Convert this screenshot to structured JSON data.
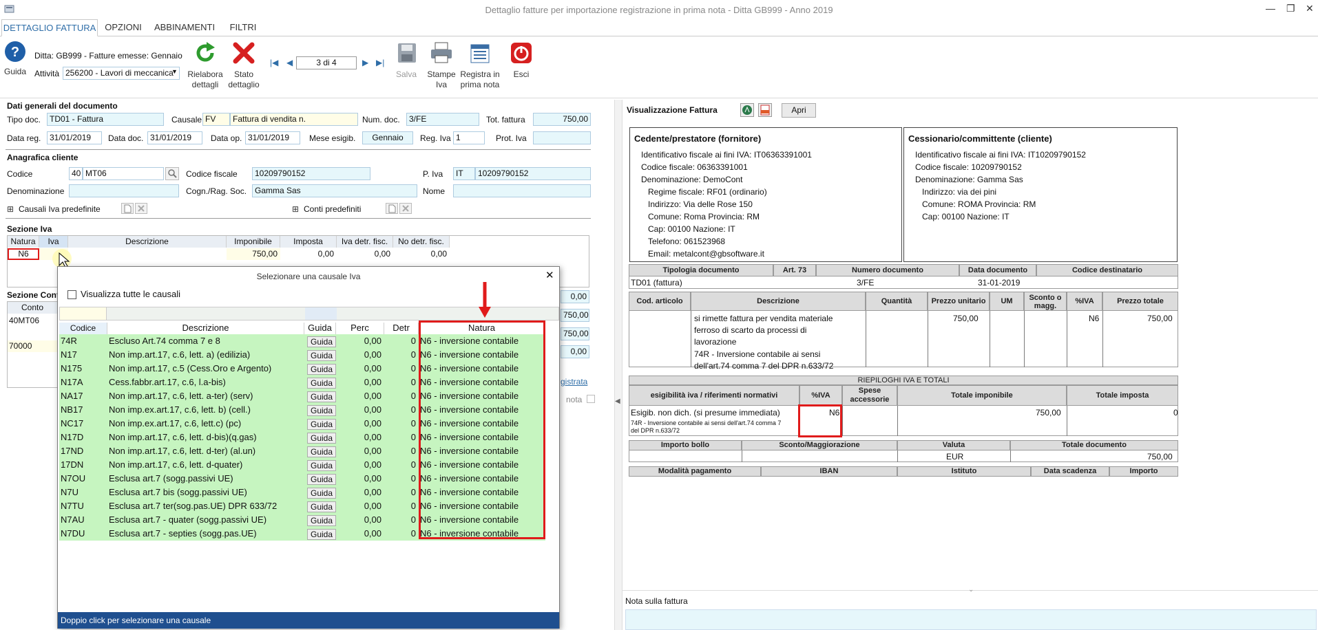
{
  "window": {
    "title": "Dettaglio fatture per importazione registrazione in prima nota - Ditta GB999 - Anno 2019",
    "minimize": "—",
    "maximize": "❐",
    "close": "✕"
  },
  "tabs": [
    "DETTAGLIO FATTURA",
    "OPZIONI",
    "ABBINAMENTI",
    "FILTRI"
  ],
  "ribbon": {
    "guida": "Guida",
    "ditta": "Ditta: GB999 - Fatture emesse: Gennaio",
    "attivita_label": "Attività",
    "attivita_value": "256200 - Lavori di meccanica",
    "rielabora": [
      "Rielabora",
      "dettagli"
    ],
    "stato": [
      "Stato",
      "dettaglio"
    ],
    "pager": "3 di 4",
    "salva": "Salva",
    "stampe": [
      "Stampe",
      "Iva"
    ],
    "registra": [
      "Registra in",
      "prima nota"
    ],
    "esci": "Esci"
  },
  "dati": {
    "section": "Dati generali del documento",
    "tipo_label": "Tipo doc.",
    "tipo_value": "TD01 - Fattura",
    "causale_label": "Causale",
    "causale_code": "FV",
    "causale_desc": "Fattura di vendita n.",
    "num_label": "Num. doc.",
    "num_value": "3/FE",
    "tot_label": "Tot. fattura",
    "tot_value": "750,00",
    "datareg_label": "Data reg.",
    "datareg_value": "31/01/2019",
    "datadoc_label": "Data doc.",
    "datadoc_value": "31/01/2019",
    "dataop_label": "Data op.",
    "dataop_value": "31/01/2019",
    "mese_label": "Mese esigib.",
    "mese_value": "Gennaio",
    "regiva_label": "Reg. Iva",
    "regiva_value": "1",
    "prot_label": "Prot. Iva",
    "prot_value": ""
  },
  "cliente": {
    "section": "Anagrafica cliente",
    "codice_label": "Codice",
    "codice_a": "40",
    "codice_b": "MT06",
    "cf_label": "Codice fiscale",
    "cf_value": "10209790152",
    "piva_label": "P. Iva",
    "piva_country": "IT",
    "piva_value": "10209790152",
    "denom_label": "Denominazione",
    "denom_value": "",
    "cogn_label": "Cogn./Rag. Soc.",
    "cogn_value": "Gamma Sas",
    "nome_label": "Nome",
    "nome_value": "",
    "causali_pred": "Causali Iva predefinite",
    "conti_pred": "Conti predefiniti",
    "expand": "⊞"
  },
  "iva": {
    "section": "Sezione Iva",
    "headers": [
      "Natura",
      "Iva",
      "Descrizione",
      "Imponibile",
      "Imposta",
      "Iva detr. fisc.",
      "No detr. fisc."
    ],
    "row": {
      "natura": "N6",
      "iva": "",
      "descrizione": "",
      "imponibile": "750,00",
      "imposta": "0,00",
      "detr": "0,00",
      "nodetr": "0,00"
    }
  },
  "conti": {
    "section": "Sezione Cont",
    "col": "Conto",
    "rows": [
      "40MT06",
      "",
      "70000"
    ],
    "right_values": [
      "0,00",
      "750,00",
      "750,00",
      "0,00"
    ],
    "link": "gistrata",
    "nota": "nota"
  },
  "popup": {
    "title": "Selezionare una causale Iva",
    "close": "✕",
    "checkbox_label": "Visualizza tutte le causali",
    "headers": [
      "Codice",
      "Descrizione",
      "Guida",
      "Perc",
      "Detr",
      "Natura"
    ],
    "rows": [
      {
        "codice": "74R",
        "desc": "Escluso Art.74 comma 7 e 8",
        "guida": "Guida",
        "perc": "0,00",
        "detr": "0",
        "natura": "N6 - inversione contabile"
      },
      {
        "codice": "N17",
        "desc": "Non imp.art.17, c.6, lett. a) (edilizia)",
        "guida": "Guida",
        "perc": "0,00",
        "detr": "0",
        "natura": "N6 - inversione contabile"
      },
      {
        "codice": "N175",
        "desc": "Non imp.art.17, c.5 (Cess.Oro e Argento)",
        "guida": "Guida",
        "perc": "0,00",
        "detr": "0",
        "natura": "N6 - inversione contabile"
      },
      {
        "codice": "N17A",
        "desc": "Cess.fabbr.art.17, c.6, l.a-bis)",
        "guida": "Guida",
        "perc": "0,00",
        "detr": "0",
        "natura": "N6 - inversione contabile"
      },
      {
        "codice": "NA17",
        "desc": "Non imp.art.17, c.6, lett. a-ter) (serv)",
        "guida": "Guida",
        "perc": "0,00",
        "detr": "0",
        "natura": "N6 - inversione contabile"
      },
      {
        "codice": "NB17",
        "desc": "Non imp.ex.art.17, c.6, lett. b) (cell.)",
        "guida": "Guida",
        "perc": "0,00",
        "detr": "0",
        "natura": "N6 - inversione contabile"
      },
      {
        "codice": "NC17",
        "desc": "Non imp.ex.art.17, c.6, lett.c) (pc)",
        "guida": "Guida",
        "perc": "0,00",
        "detr": "0",
        "natura": "N6 - inversione contabile"
      },
      {
        "codice": "N17D",
        "desc": "Non imp.art.17, c.6, lett. d-bis)(q.gas)",
        "guida": "Guida",
        "perc": "0,00",
        "detr": "0",
        "natura": "N6 - inversione contabile"
      },
      {
        "codice": "17ND",
        "desc": "Non imp.art.17, c.6, lett. d-ter) (al.un)",
        "guida": "Guida",
        "perc": "0,00",
        "detr": "0",
        "natura": "N6 - inversione contabile"
      },
      {
        "codice": "17DN",
        "desc": "Non imp.art.17, c.6, lett. d-quater)",
        "guida": "Guida",
        "perc": "0,00",
        "detr": "0",
        "natura": "N6 - inversione contabile"
      },
      {
        "codice": "N7OU",
        "desc": "Esclusa art.7 (sogg.passivi UE)",
        "guida": "Guida",
        "perc": "0,00",
        "detr": "0",
        "natura": "N6 - inversione contabile"
      },
      {
        "codice": "N7U",
        "desc": "Esclusa art.7 bis (sogg.passivi UE)",
        "guida": "Guida",
        "perc": "0,00",
        "detr": "0",
        "natura": "N6 - inversione contabile"
      },
      {
        "codice": "N7TU",
        "desc": "Esclusa art.7 ter(sog.pas.UE) DPR 633/72",
        "guida": "Guida",
        "perc": "0,00",
        "detr": "0",
        "natura": "N6 - inversione contabile"
      },
      {
        "codice": "N7AU",
        "desc": "Esclusa art.7 - quater (sogg.passivi UE)",
        "guida": "Guida",
        "perc": "0,00",
        "detr": "0",
        "natura": "N6 - inversione contabile"
      },
      {
        "codice": "N7DU",
        "desc": "Esclusa art.7 - septies (sogg.pas.UE)",
        "guida": "Guida",
        "perc": "0,00",
        "detr": "0",
        "natura": "N6 - inversione contabile"
      }
    ],
    "status": "Doppio click per selezionare una causale"
  },
  "fattura": {
    "title": "Visualizzazione Fattura",
    "apri": "Apri",
    "cedente_title": "Cedente/prestatore (fornitore)",
    "cedente": [
      "Identificativo fiscale ai fini IVA: IT06363391001",
      "Codice fiscale: 06363391001",
      "Denominazione: DemoCont",
      "Regime fiscale: RF01 (ordinario)",
      "Indirizzo: Via delle Rose 150",
      "Comune: Roma Provincia: RM",
      "Cap: 00100 Nazione: IT",
      "Telefono: 061523968",
      "Email: metalcont@gbsoftware.it"
    ],
    "cessionario_title": "Cessionario/committente (cliente)",
    "cessionario": [
      "Identificativo fiscale ai fini IVA: IT10209790152",
      "Codice fiscale: 10209790152",
      "Denominazione: Gamma Sas",
      "Indirizzo: via dei pini",
      "Comune: ROMA Provincia: RM",
      "Cap: 00100 Nazione: IT"
    ],
    "doc_headers": [
      "Tipologia documento",
      "Art. 73",
      "Numero documento",
      "Data documento",
      "Codice destinatario"
    ],
    "doc_values": [
      "TD01 (fattura)",
      "",
      "3/FE",
      "31-01-2019",
      ""
    ],
    "item_headers": [
      "Cod. articolo",
      "Descrizione",
      "Quantità",
      "Prezzo unitario",
      "UM",
      "Sconto o magg.",
      "%IVA",
      "Prezzo totale"
    ],
    "item_desc": [
      "si rimette fattura per vendita materiale",
      "ferroso di scarto da processi di",
      "lavorazione"
    ],
    "item_desc2": [
      "74R - Inversione contabile ai sensi",
      "dell'art.74 comma 7 del DPR n.633/72"
    ],
    "item_prezzo": "750,00",
    "item_iva": "N6",
    "item_tot": "750,00",
    "riepilogo": "RIEPILOGHI IVA E TOTALI",
    "riep_headers": [
      "esigibilità iva / riferimenti normativi",
      "%IVA",
      "Spese accessorie",
      "Totale imponibile",
      "Totale imposta"
    ],
    "riep_esig": "Esigib. non dich. (si presume immediata)",
    "riep_note": [
      "74R - Inversione contabile ai sensi dell'art.74 comma 7",
      "del DPR n.633/72"
    ],
    "riep_iva": "N6",
    "riep_imp": "750,00",
    "riep_imposta": "0",
    "tot_headers": [
      "Importo bollo",
      "Sconto/Maggiorazione",
      "Valuta",
      "Totale documento"
    ],
    "valuta": "EUR",
    "totale": "750,00",
    "pag_headers": [
      "Modalità pagamento",
      "IBAN",
      "Istituto",
      "Data scadenza",
      "Importo"
    ],
    "nota": "Nota sulla fattura"
  },
  "colors": {
    "accent": "#2f6ea8",
    "highlight_red": "#e01b1b",
    "row_green": "#c6f5c0",
    "status_blue": "#1f4f8f"
  }
}
